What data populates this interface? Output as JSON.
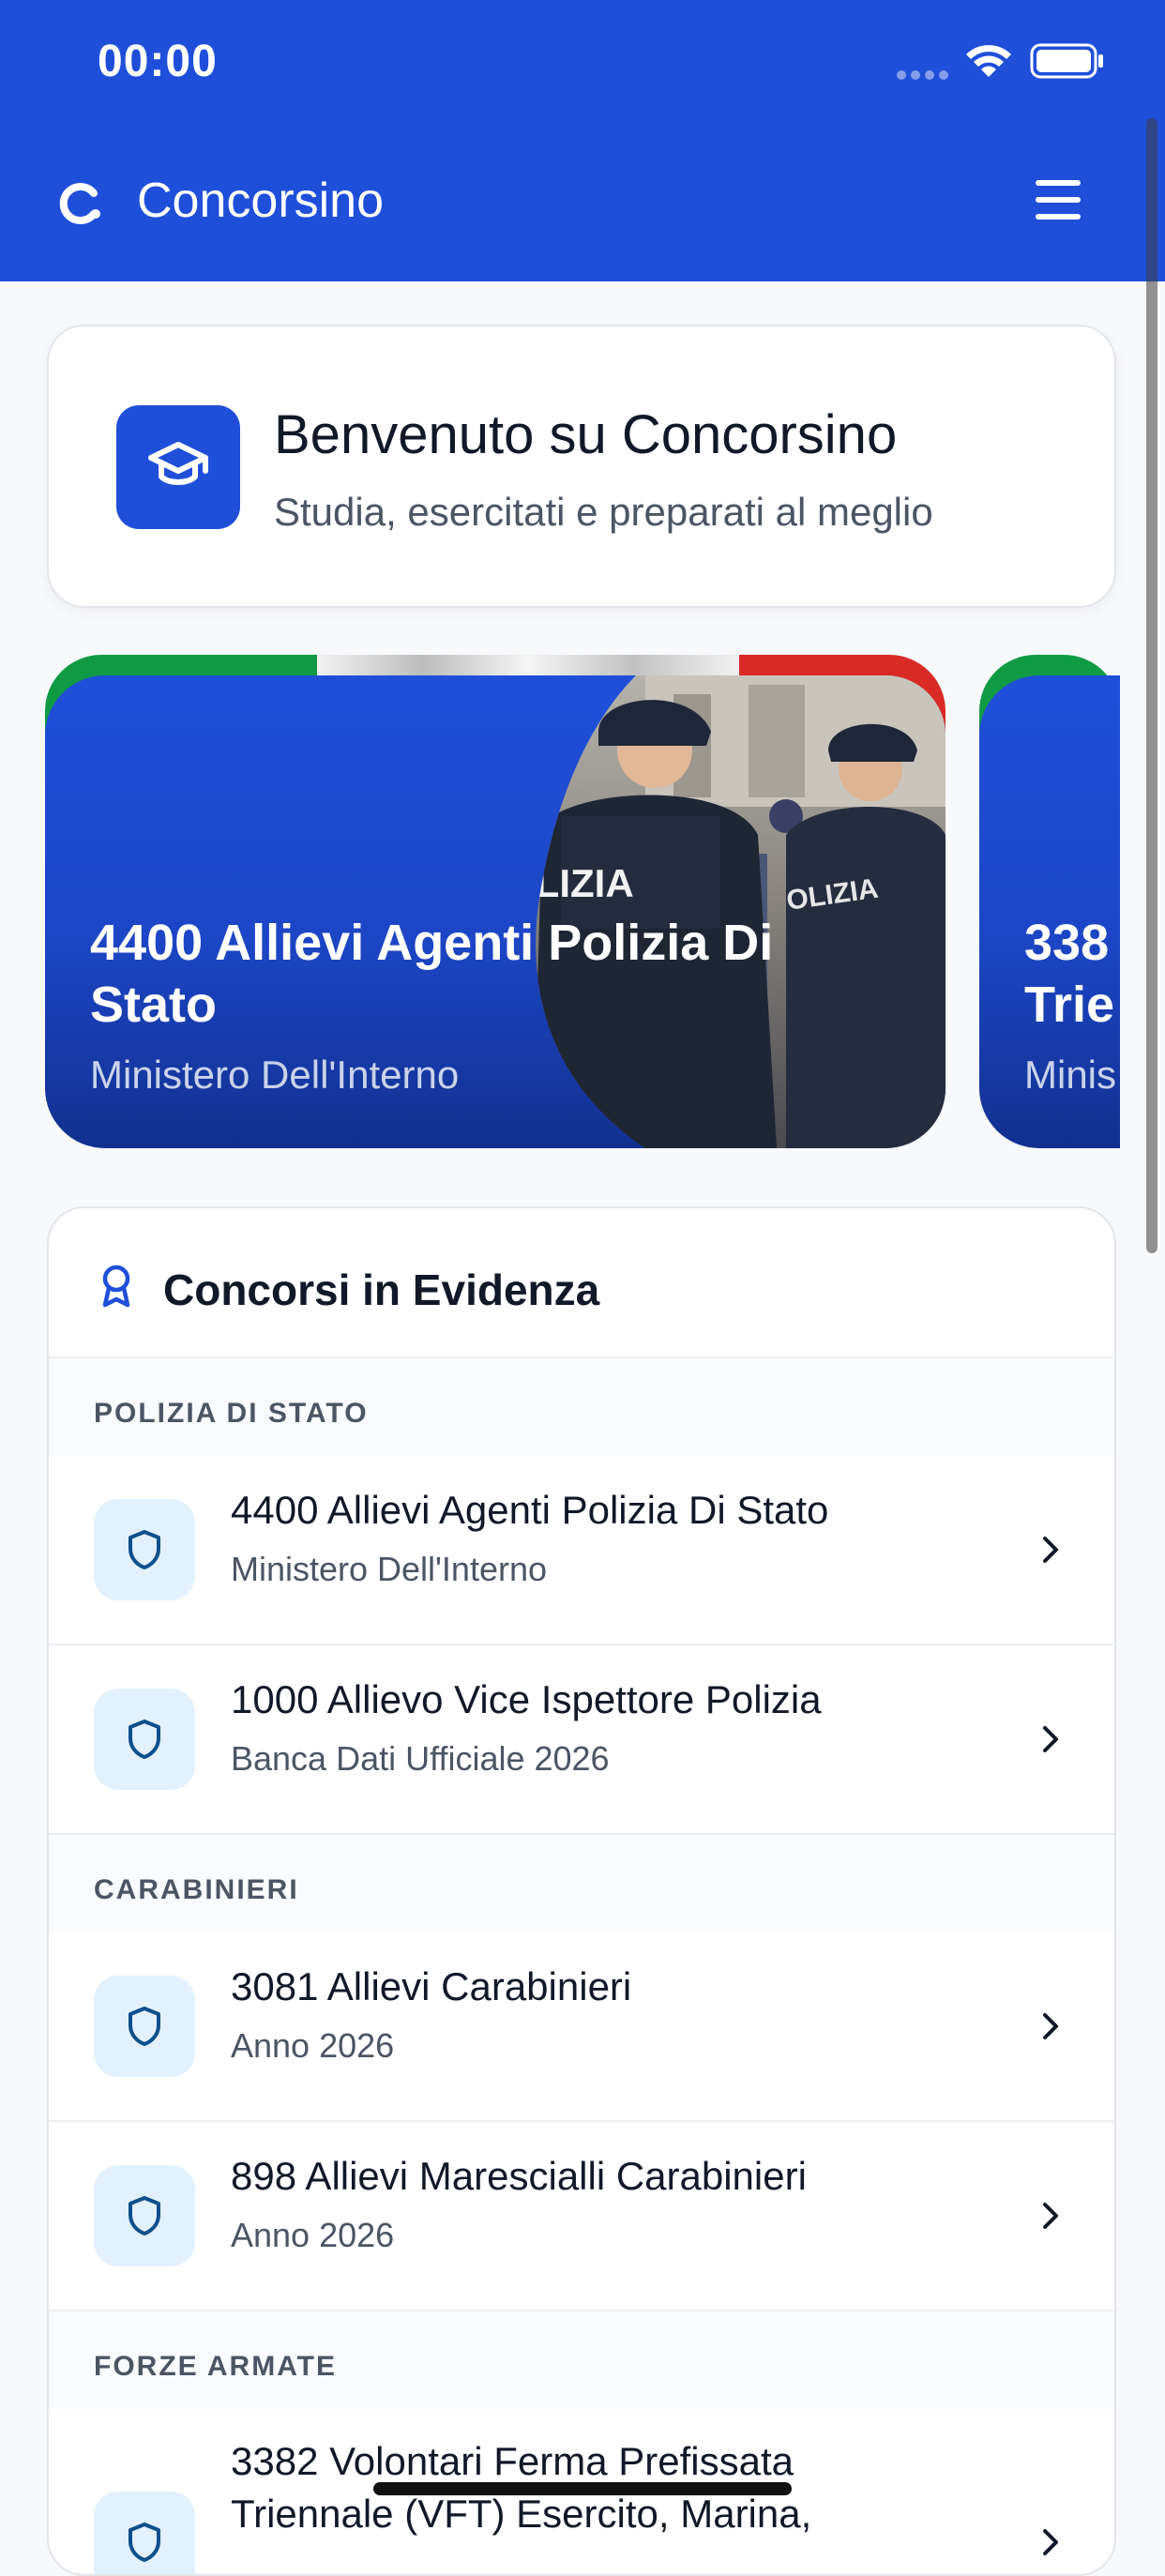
{
  "status_bar": {
    "time": "00:00"
  },
  "app_bar": {
    "app_name": "Concorsino",
    "logo_icon": "concorsino-logo-icon",
    "menu_icon": "hamburger-icon"
  },
  "welcome": {
    "title": "Benvenuto su Concorsino",
    "subtitle": "Studia, esercitati e preparati al meglio",
    "icon": "graduation-cap-icon"
  },
  "carousel": {
    "slides": [
      {
        "title": "4400 Allievi Agenti Polizia Di Stato",
        "organization": "Ministero Dell'Interno",
        "photo_text": "POLIZIA"
      },
      {
        "title": "338 Trie",
        "organization": "Minis"
      }
    ]
  },
  "featured": {
    "title": "Concorsi in Evidenza",
    "icon": "award-ribbon-icon",
    "sections": [
      {
        "label": "POLIZIA DI STATO",
        "items": [
          {
            "title": "4400 Allievi Agenti Polizia Di Stato",
            "subtitle": "Ministero Dell'Interno",
            "icon": "shield-icon"
          },
          {
            "title": "1000 Allievo Vice Ispettore Polizia",
            "subtitle": "Banca Dati Ufficiale 2026",
            "icon": "shield-icon"
          }
        ]
      },
      {
        "label": "CARABINIERI",
        "items": [
          {
            "title": "3081 Allievi Carabinieri",
            "subtitle": "Anno 2026",
            "icon": "shield-icon"
          },
          {
            "title": "898 Allievi Marescialli Carabinieri",
            "subtitle": "Anno 2026",
            "icon": "shield-icon"
          }
        ]
      },
      {
        "label": "FORZE ARMATE",
        "items": [
          {
            "title": "3382 Volontari Ferma Prefissata Triennale (VFT) Esercito, Marina,",
            "subtitle": "",
            "icon": "shield-icon"
          }
        ]
      }
    ]
  },
  "colors": {
    "primary": "#1f4fd9",
    "icon_tile_bg": "#e2f1fd",
    "icon_tile_fg": "#0d4f8b",
    "flag_green": "#119a44",
    "flag_white": "#f2f2f2",
    "flag_red": "#d92a26"
  }
}
